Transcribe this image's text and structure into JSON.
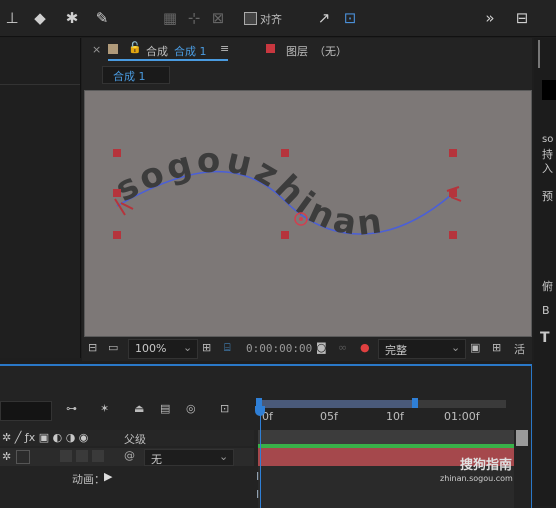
{
  "toolbar": {
    "align_label": "对齐",
    "icons": [
      "stamp-icon",
      "eraser-icon",
      "puppet-icon",
      "pin-icon",
      "align-left-icon",
      "anchor-icon",
      "chevron-icon",
      "toggle-icon"
    ]
  },
  "comp": {
    "close": "×",
    "tab_prefix": "合成",
    "tab_name": "合成 1",
    "layer_label": "图层",
    "layer_value": "（无）",
    "breadcrumb": "合成 1"
  },
  "viewer": {
    "text": "sogouzhinan"
  },
  "viewbar": {
    "zoom": "100%",
    "timecode": "0:00:00:00",
    "quality": "完整"
  },
  "right": {
    "texts": [
      "so",
      "持",
      "入",
      "预",
      "俯",
      "B",
      "T"
    ]
  },
  "timeline": {
    "ruler": [
      "0f",
      "05f",
      "10f",
      "01:00f"
    ],
    "parent_label": "父级",
    "parent_value": "无",
    "anim_label": "动画：",
    "watermark": "搜狗指南",
    "watermark_url": "zhinan.sogou.com"
  }
}
